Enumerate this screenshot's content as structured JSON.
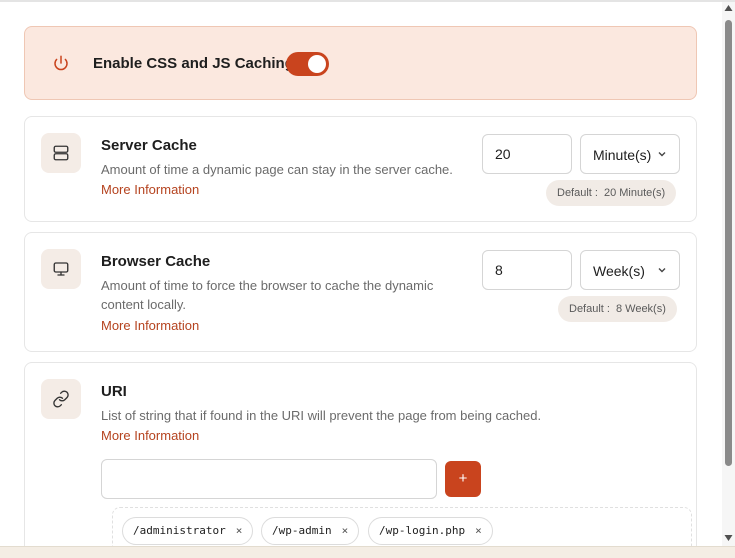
{
  "banner": {
    "label": "Enable CSS and JS Caching",
    "enabled": true
  },
  "server_cache": {
    "title": "Server Cache",
    "description": "Amount of time a dynamic page can stay in the server cache.",
    "more_info": "More Information",
    "value": "20",
    "unit": "Minute(s)",
    "default_key": "Default :",
    "default_value": "20 Minute(s)"
  },
  "browser_cache": {
    "title": "Browser Cache",
    "description_line1": "Amount of time to force the browser to cache the dynamic",
    "description_line2": "content locally.",
    "more_info": "More Information",
    "value": "8",
    "unit": "Week(s)",
    "default_key": "Default :",
    "default_value": "8 Week(s)"
  },
  "uri": {
    "title": "URI",
    "description": "List of string that if found in the URI will prevent the page from being cached.",
    "more_info": "More Information",
    "input_value": "",
    "add_label": "+",
    "chips": [
      {
        "label": "/administrator",
        "remove": "×"
      },
      {
        "label": "/wp-admin",
        "remove": "×"
      },
      {
        "label": "/wp-login.php",
        "remove": "×"
      }
    ]
  },
  "colors": {
    "accent": "#c9441e",
    "link": "#b5431f",
    "banner_bg": "#fbe8df",
    "icon_bg": "#f4ece6"
  },
  "icons": {
    "banner": "power-icon",
    "server": "server-icon",
    "browser": "monitor-icon",
    "uri": "link-icon",
    "select": "chevron-down-icon"
  }
}
